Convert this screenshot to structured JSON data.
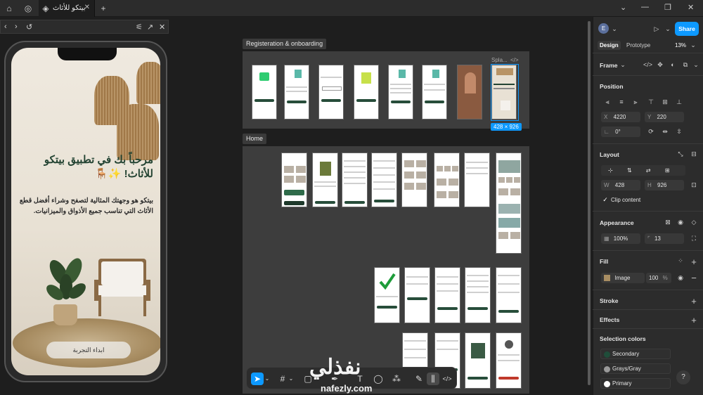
{
  "tabbar": {
    "tab_title": "بيتكو للأثاث",
    "new_tab": "+",
    "minimize": "—",
    "restore": "❐",
    "close": "✕"
  },
  "preview": {
    "title": "مرحباً بك في تطبيق بيتكو للأثاث! ✨🪑",
    "body": "بيتكو هو وجهتك المثالية لتصفح وشراء أفضل قطع الأثاث التي تناسب جميع الأذواق والميزانيات.",
    "button": "ابداء التجربة"
  },
  "sections": {
    "onboarding_label": "Registeration & onboarding",
    "home_label": "Home",
    "selected_frame_label": "Spla...",
    "selected_frame_size": "428 × 926"
  },
  "watermark": {
    "arabic": "نفذلي",
    "latin": "nafezly.com"
  },
  "right_panel": {
    "avatar": "E",
    "share": "Share",
    "tab_design": "Design",
    "tab_prototype": "Prototype",
    "zoom": "13%",
    "frame_label": "Frame",
    "position_title": "Position",
    "x_label": "X",
    "x_value": "4220",
    "y_label": "Y",
    "y_value": "220",
    "rotation": "0°",
    "layout_title": "Layout",
    "w_label": "W",
    "w_value": "428",
    "h_label": "H",
    "h_value": "926",
    "clip_content": "Clip content",
    "appearance_title": "Appearance",
    "opacity": "100%",
    "radius": "13",
    "fill_title": "Fill",
    "fill_type": "Image",
    "fill_opacity": "100",
    "fill_percent": "%",
    "stroke_title": "Stroke",
    "effects_title": "Effects",
    "selection_colors_title": "Selection colors",
    "colors": [
      {
        "name": "Secondary",
        "hex": "#1f4d3a"
      },
      {
        "name": "Grays/Gray",
        "hex": "#9a9a9a"
      },
      {
        "name": "Primary",
        "hex": "#ffffff"
      }
    ],
    "help": "?"
  }
}
